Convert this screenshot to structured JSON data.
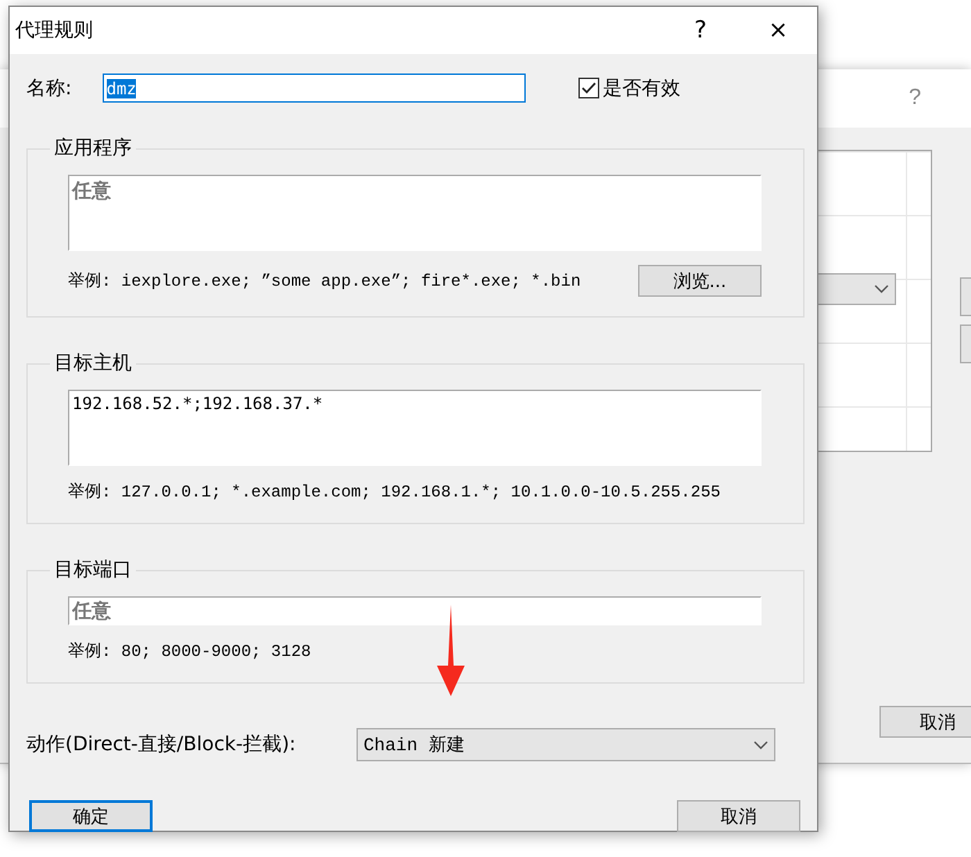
{
  "background_window": {
    "help": "?",
    "cancel_button": "取消"
  },
  "dialog": {
    "title": "代理规则",
    "help": "?",
    "close": "×"
  },
  "name": {
    "label": "名称:",
    "value": "dmz",
    "selected": true
  },
  "enabled": {
    "label": "是否有效",
    "checked": true
  },
  "groups": [
    {
      "title": "应用程序",
      "kind": "textarea",
      "placeholder": "任意",
      "example": "举例: iexplore.exe; ”some app.exe”; fire*.exe; *.bin",
      "browse_button": "浏览..."
    },
    {
      "title": "目标主机",
      "kind": "textarea",
      "value": "192.168.52.*;192.168.37.*",
      "example": "举例: 127.0.0.1; *.example.com; 192.168.1.*; 10.1.0.0-10.5.255.255"
    },
    {
      "title": "目标端口",
      "kind": "input",
      "placeholder": "任意",
      "example": "举例: 80; 8000-9000; 3128"
    }
  ],
  "action": {
    "label": "动作(Direct-直接/Block-拦截):",
    "value": "Chain 新建"
  },
  "buttons": [
    {
      "label": "确定",
      "focused": true
    },
    {
      "label": "取消",
      "focused": false
    }
  ]
}
